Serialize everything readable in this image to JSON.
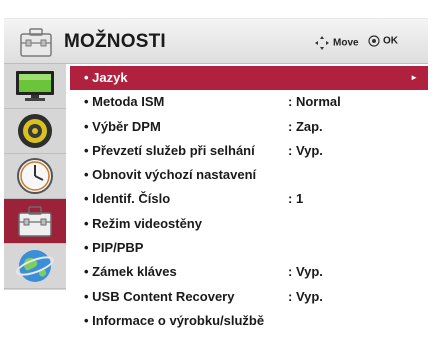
{
  "header": {
    "title": "MOŽNOSTI",
    "hints": {
      "move": "Move",
      "ok": "OK"
    }
  },
  "sidebar": {
    "items": [
      {
        "icon": "picture-monitor-icon"
      },
      {
        "icon": "speaker-audio-icon"
      },
      {
        "icon": "clock-time-icon"
      },
      {
        "icon": "toolbox-option-icon",
        "active": true
      },
      {
        "icon": "globe-network-icon"
      }
    ]
  },
  "menu": {
    "items": [
      {
        "label": "• Jazyk",
        "value": "",
        "selected": true,
        "arrow": "►"
      },
      {
        "label": "• Metoda ISM",
        "value": ": Normal"
      },
      {
        "label": "• Výběr DPM",
        "value": ": Zap."
      },
      {
        "label": "• Převzetí služeb při selhání",
        "value": ": Vyp."
      },
      {
        "label": "• Obnovit výchozí nastavení",
        "value": ""
      },
      {
        "label": "• Identif. Číslo",
        "value": ": 1"
      },
      {
        "label": "• Režim videostěny",
        "value": ""
      },
      {
        "label": "• PIP/PBP",
        "value": ""
      },
      {
        "label": "• Zámek kláves",
        "value": ": Vyp."
      },
      {
        "label": "• USB Content Recovery",
        "value": ": Vyp."
      },
      {
        "label": "• Informace o výrobku/službě",
        "value": ""
      }
    ]
  },
  "colors": {
    "selected_row": "#b0203f",
    "active_sidebar": "#9b2238",
    "sidebar_bg": "#d6d6d6"
  }
}
